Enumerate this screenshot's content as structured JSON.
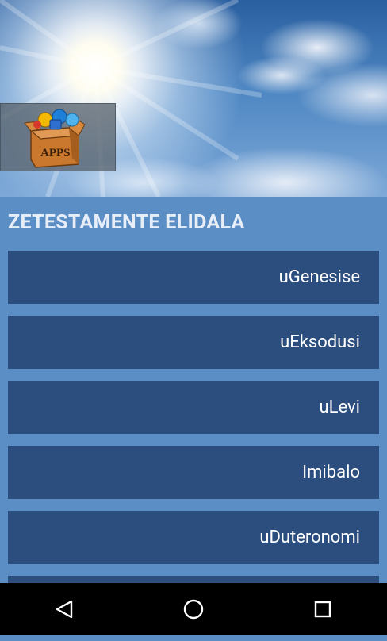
{
  "header": {
    "logo_icon": "apps-box-logo-icon",
    "logo_text": "APPS"
  },
  "section_title": "ZETESTAMENTE ELIDALA",
  "books": [
    {
      "label": "uGenesise"
    },
    {
      "label": "uEksodusi"
    },
    {
      "label": "uLevi"
    },
    {
      "label": "Imibalo"
    },
    {
      "label": "uDuteronomi"
    },
    {
      "label": ""
    }
  ],
  "navbar": {
    "back_icon": "back-triangle-icon",
    "home_icon": "home-circle-icon",
    "recents_icon": "recents-square-icon"
  },
  "colors": {
    "page_bg": "#5b8ec4",
    "list_item_bg": "#2b4e7e",
    "title_text": "#e8eef8",
    "navbar_bg": "#000000"
  }
}
